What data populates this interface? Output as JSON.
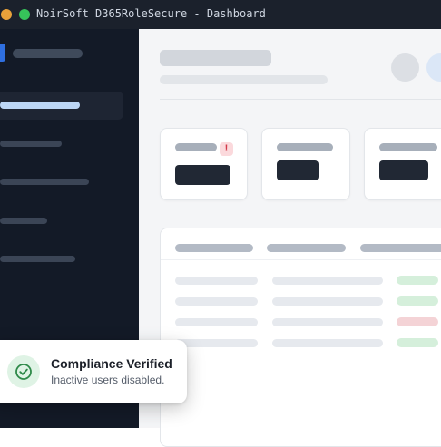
{
  "window": {
    "title": "NoirSoft D365RoleSecure - Dashboard"
  },
  "toast": {
    "title": "Compliance Verified",
    "message": "Inactive users disabled.",
    "icon": "check-circle-icon",
    "accent_color": "#2f8a4a"
  },
  "colors": {
    "sidebar_bg": "#131a27",
    "titlebar_bg": "#1b212c",
    "alert_red": "#d23a4a",
    "status_green": "#d5efdb",
    "status_red": "#f4d3d6"
  },
  "table": {
    "status_pills": [
      "green",
      "green",
      "red",
      "green"
    ]
  }
}
